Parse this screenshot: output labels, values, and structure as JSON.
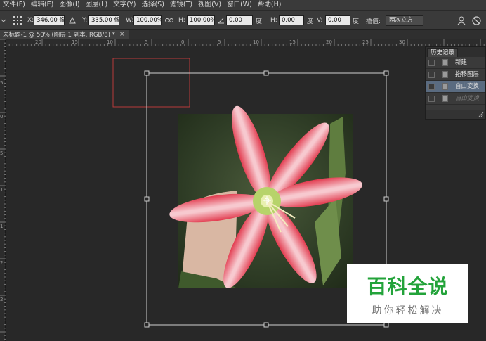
{
  "menu": [
    "文件(F)",
    "编辑(E)",
    "图像(I)",
    "图层(L)",
    "文字(Y)",
    "选择(S)",
    "滤镜(T)",
    "视图(V)",
    "窗口(W)",
    "帮助(H)"
  ],
  "options": {
    "x_label": "X:",
    "x_value": "346.00 像",
    "y_label": "Y:",
    "y_value": "335.00 像",
    "w_label": "W:",
    "w_value": "100.00%",
    "h_label": "H:",
    "h_value": "100.00%",
    "angle_value": "0.00",
    "angle_unit": "度",
    "hskew_label": "H:",
    "hskew_value": "0.00",
    "hskew_unit": "度",
    "vskew_label": "V:",
    "vskew_value": "0.00",
    "vskew_unit": "度",
    "interp_label": "插值:",
    "interp_value": "两次立方"
  },
  "document_tab": {
    "title": "未标题-1 @ 50% (图层 1 副本, RGB/8) *",
    "close": "×"
  },
  "ruler_h_labels": [
    "20",
    "15",
    "10",
    "5",
    "0",
    "5",
    "10",
    "15",
    "20",
    "25",
    "30"
  ],
  "ruler_v_labels": [
    "5",
    "0",
    "5",
    "1",
    "1",
    "2",
    "2"
  ],
  "history": {
    "tab": "历史记录",
    "items": [
      {
        "label": "新建",
        "state": "normal"
      },
      {
        "label": "拖移图层",
        "state": "normal"
      },
      {
        "label": "自由变换",
        "state": "selected"
      },
      {
        "label": "自由变换",
        "state": "dim"
      }
    ]
  },
  "watermark": {
    "line1": "百科全说",
    "line2": "助你轻松解决"
  },
  "colors": {
    "chrome": "#3a3a3a",
    "canvas": "#282828",
    "selection": "#5a6b80",
    "watermark_green": "#23a33a",
    "red_box": "#b83a3a"
  }
}
